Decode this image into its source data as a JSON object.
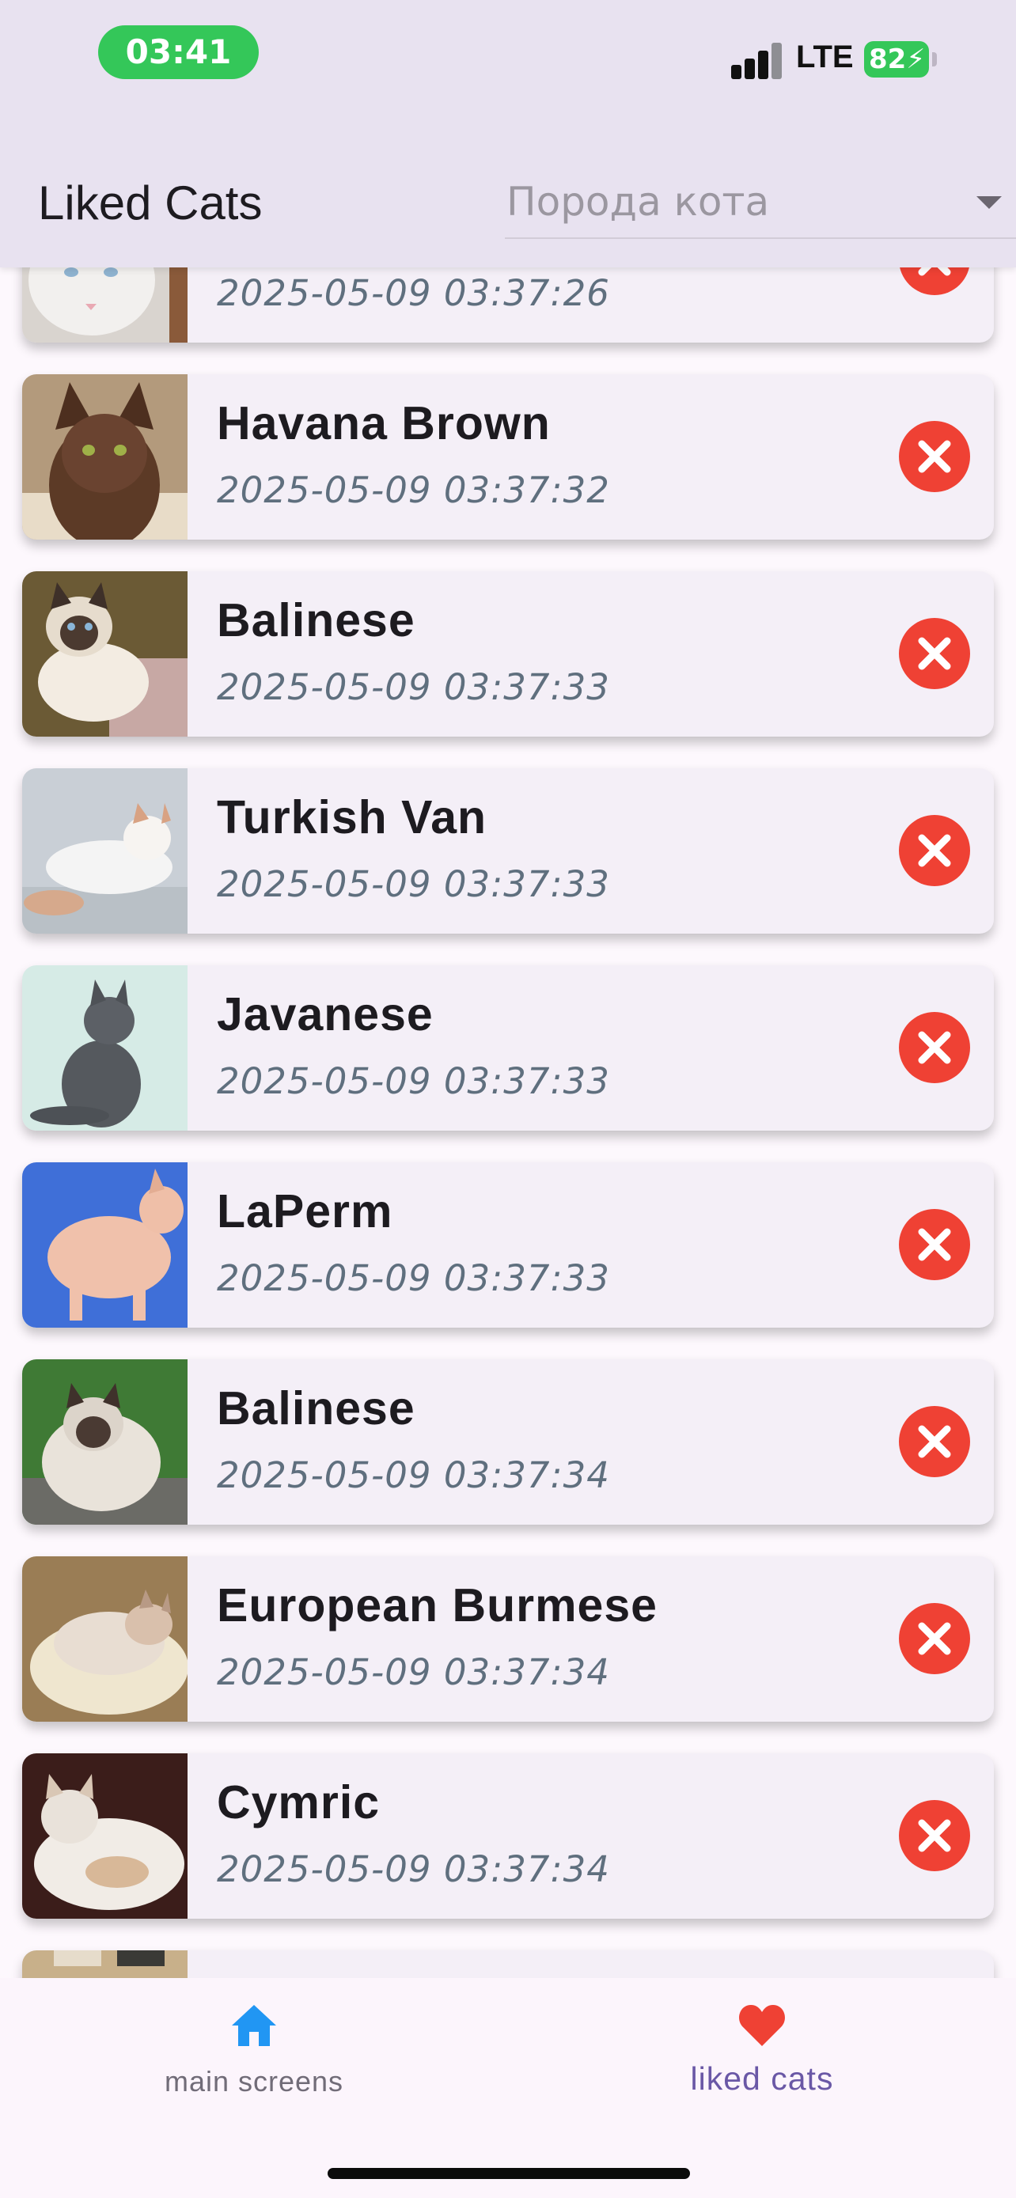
{
  "status_bar": {
    "time": "03:41",
    "network": "LTE",
    "battery": "82"
  },
  "app_bar": {
    "title": "Liked Cats",
    "breed_filter_placeholder": "Порода кота"
  },
  "liked_cats": [
    {
      "name": "",
      "date": "2025-05-09 03:37:26"
    },
    {
      "name": "Havana Brown",
      "date": "2025-05-09 03:37:32"
    },
    {
      "name": "Balinese",
      "date": "2025-05-09 03:37:33"
    },
    {
      "name": "Turkish Van",
      "date": "2025-05-09 03:37:33"
    },
    {
      "name": "Javanese",
      "date": "2025-05-09 03:37:33"
    },
    {
      "name": "LaPerm",
      "date": "2025-05-09 03:37:33"
    },
    {
      "name": "Balinese",
      "date": "2025-05-09 03:37:34"
    },
    {
      "name": "European Burmese",
      "date": "2025-05-09 03:37:34"
    },
    {
      "name": "Cymric",
      "date": "2025-05-09 03:37:34"
    },
    {
      "name": "",
      "date": ""
    }
  ],
  "bottom_nav": {
    "items": [
      {
        "label": "main screens",
        "icon": "home-icon",
        "active": false
      },
      {
        "label": "liked cats",
        "icon": "heart-icon",
        "active": true
      }
    ]
  },
  "colors": {
    "app_bar_bg": "#e8e2f0",
    "card_bg": "#f4eff7",
    "remove_button": "#ef4134",
    "nav_active": "#6a58a6",
    "home_icon": "#2196f3",
    "heart_icon": "#ef4134",
    "status_green": "#34c759"
  }
}
